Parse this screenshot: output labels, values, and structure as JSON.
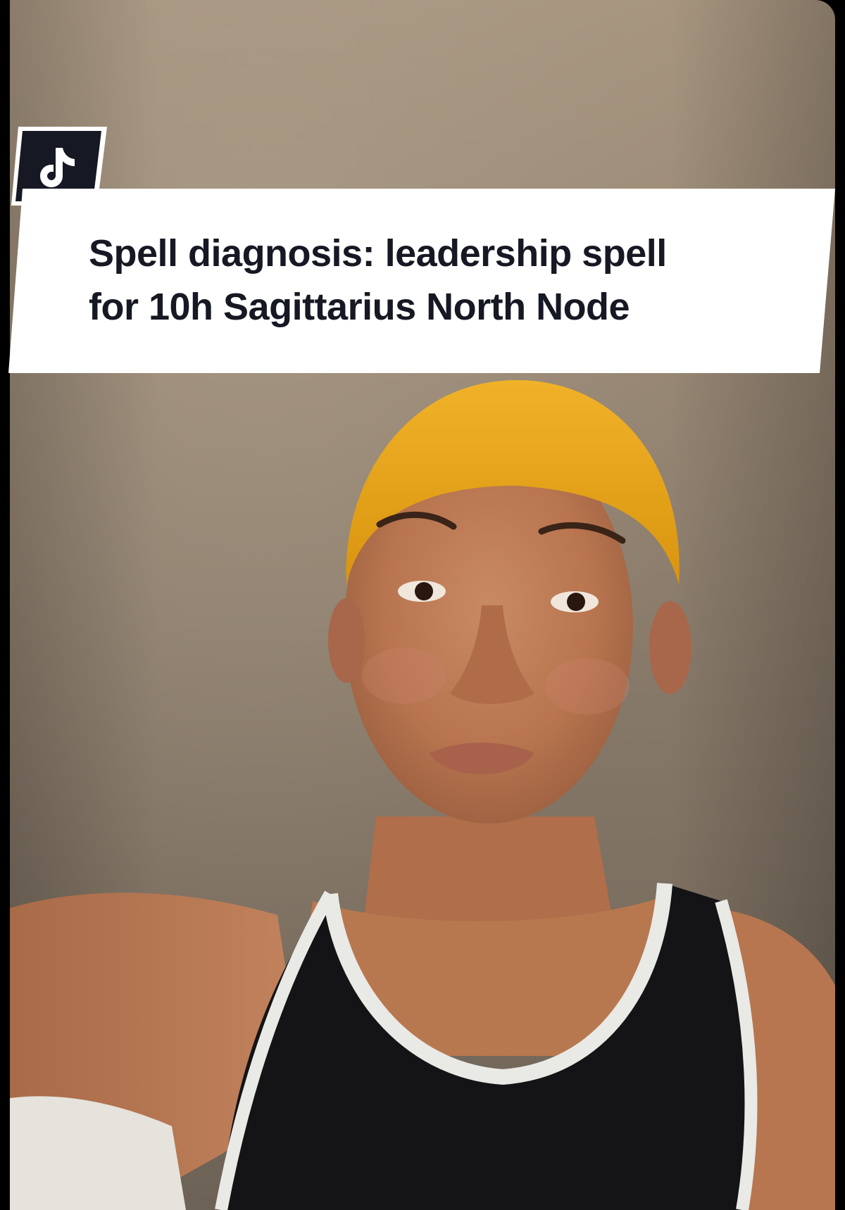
{
  "overlay": {
    "logo_icon": "tiktok-logo-icon",
    "caption": {
      "line1": "Spell diagnosis: leadership spell",
      "line2": "for 10h Sagittarius North Node"
    }
  },
  "colors": {
    "banner_background": "#ffffff",
    "banner_text": "#161823",
    "logo_badge": "#161823",
    "logo_glyph": "#ffffff",
    "headwrap": "#e8a417",
    "tank_top": "#141416",
    "tank_trim": "#e9e9e6",
    "background_wall": "#9c8b77"
  }
}
